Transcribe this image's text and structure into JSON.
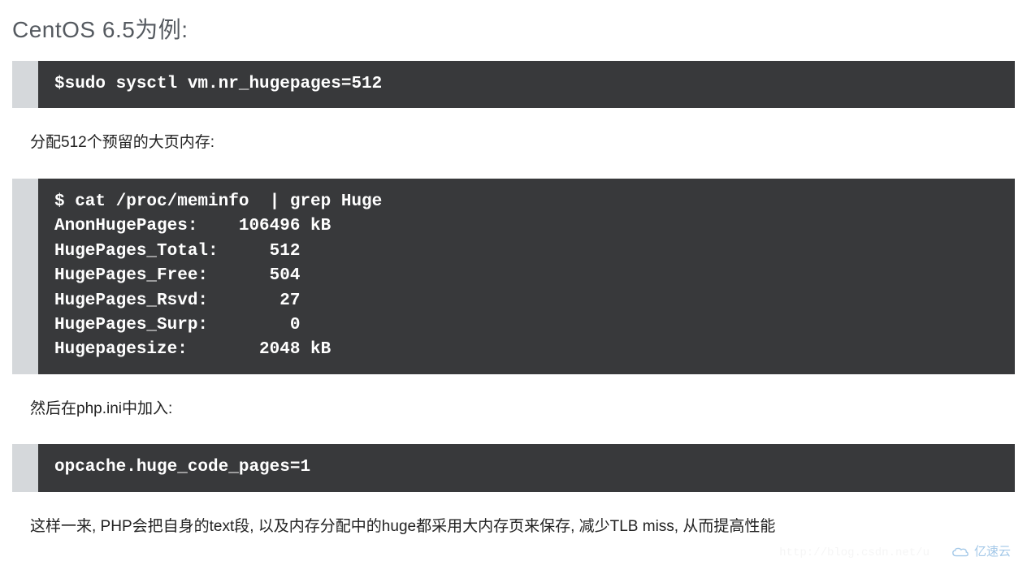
{
  "heading": "CentOS 6.5为例:",
  "code_blocks": {
    "block1": "$sudo sysctl vm.nr_hugepages=512",
    "block2": "$ cat /proc/meminfo  | grep Huge\nAnonHugePages:    106496 kB\nHugePages_Total:     512\nHugePages_Free:      504\nHugePages_Rsvd:       27\nHugePages_Surp:        0\nHugepagesize:       2048 kB",
    "block3": "opcache.huge_code_pages=1"
  },
  "paragraphs": {
    "p1": "分配512个预留的大页内存:",
    "p2": "然后在php.ini中加入:",
    "p3": "这样一来, PHP会把自身的text段, 以及内存分配中的huge都采用大内存页来保存, 减少TLB miss, 从而提高性能"
  },
  "watermark": {
    "brand": "亿速云",
    "faint_url": "http://blog.csdn.net/u"
  }
}
